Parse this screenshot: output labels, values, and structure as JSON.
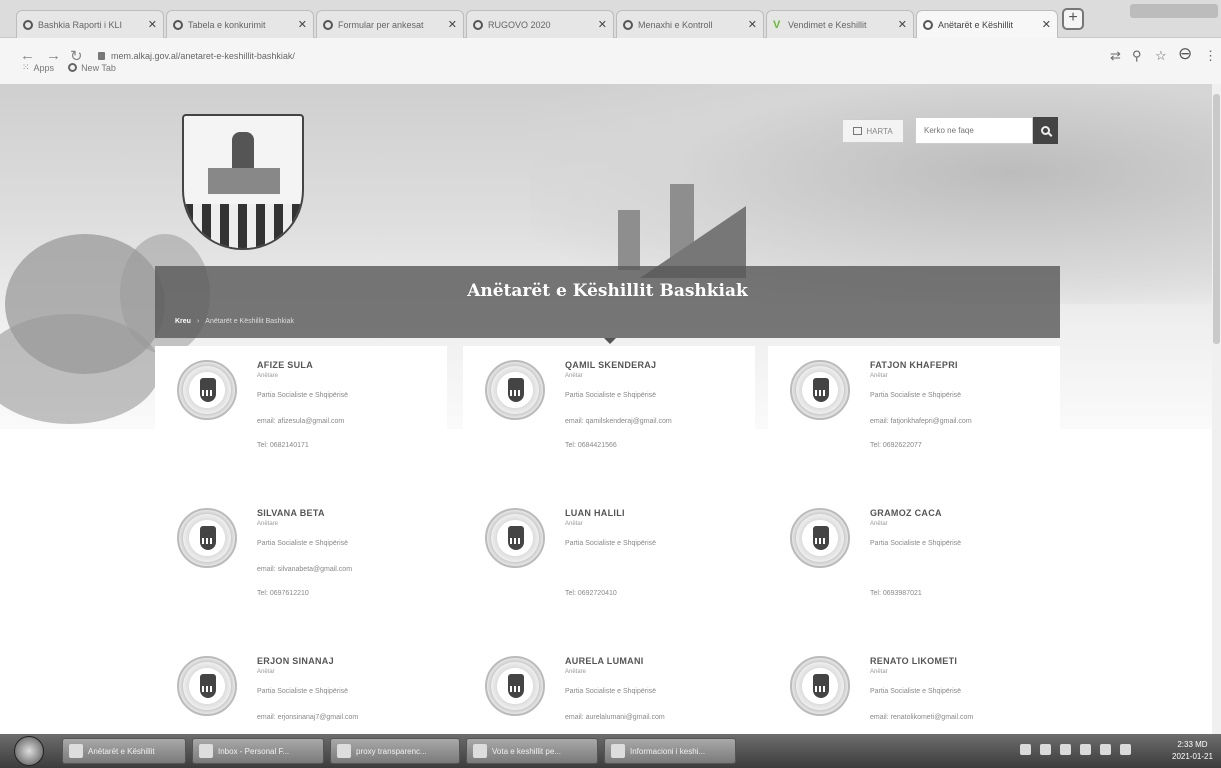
{
  "browser": {
    "tabs": [
      {
        "title": "Bashkia Raporti i KLI",
        "icon": "globe-icon"
      },
      {
        "title": "Tabela e konkurimit",
        "icon": "globe-icon"
      },
      {
        "title": "Formular per ankesat",
        "icon": "globe-icon"
      },
      {
        "title": "RUGOVO 2020",
        "icon": "globe-icon"
      },
      {
        "title": "Menaxhi e Kontroll",
        "icon": "globe-icon"
      },
      {
        "title": "Vendimet e Keshillit",
        "icon": "v-icon"
      },
      {
        "title": "Anëtarët e Këshillit",
        "icon": "globe-icon"
      }
    ],
    "new_tab_label": "+",
    "url": "mem.alkaj.gov.al/anetaret-e-keshillit-bashkiak/",
    "bookmarks": [
      "Apps",
      "New Tab"
    ]
  },
  "site": {
    "map_button": "HARTA",
    "search_placeholder": "Kerko ne faqe",
    "banner_title": "Anëtarët e Këshillit Bashkiak",
    "breadcrumb": [
      "Kreu",
      "Anëtarët e Këshillit Bashkiak"
    ]
  },
  "members": [
    {
      "name": "AFIZE SULA",
      "role": "Anëtare",
      "party": "Partia Socialiste e Shqipërisë",
      "email": "email: afizesula@gmail.com",
      "tel": "Tel: 0682140171"
    },
    {
      "name": "QAMIL SKENDERAJ",
      "role": "Anëtar",
      "party": "Partia Socialiste e Shqipërisë",
      "email": "email: qamilskenderaj@gmail.com",
      "tel": "Tel: 0684421566"
    },
    {
      "name": "FATJON KHAFEPRI",
      "role": "Anëtar",
      "party": "Partia Socialiste e Shqipërisë",
      "email": "email: fatjonkhafepri@gmail.com",
      "tel": "Tel: 0692622077"
    },
    {
      "name": "SILVANA BETA",
      "role": "Anëtare",
      "party": "Partia Socialiste e Shqipërisë",
      "email": "email: silvanabeta@gmail.com",
      "tel": "Tel: 0697612210"
    },
    {
      "name": "LUAN HALILI",
      "role": "Anëtar",
      "party": "Partia Socialiste e Shqipërisë",
      "email": "",
      "tel": "Tel: 0692720410"
    },
    {
      "name": "GRAMOZ CACA",
      "role": "Anëtar",
      "party": "Partia Socialiste e Shqipërisë",
      "email": "",
      "tel": "Tel: 0693987021"
    },
    {
      "name": "ERJON SINANAJ",
      "role": "Anëtar",
      "party": "Partia Socialiste e Shqipërisë",
      "email": "email: erjonsinanaj7@gmail.com",
      "tel": ""
    },
    {
      "name": "AURELA LUMANI",
      "role": "Anëtare",
      "party": "Partia Socialiste e Shqipërisë",
      "email": "email: aurelalumani@gmail.com",
      "tel": ""
    },
    {
      "name": "RENATO LIKOMETI",
      "role": "Anëtar",
      "party": "Partia Socialiste e Shqipërisë",
      "email": "email: renatolikometi@gmail.com",
      "tel": ""
    }
  ],
  "taskbar": {
    "tasks": [
      "Anëtarët e Këshillit",
      "Inbox - Personal F...",
      "proxy transparenc...",
      "Vota e keshillit pe...",
      "Informacioni i keshi..."
    ],
    "clock_time": "2:33 MD",
    "clock_date": "2021-01-21"
  },
  "colors": {
    "banner": "#5a5a5a",
    "search_button": "#444444",
    "card_bg": "#ffffff"
  }
}
